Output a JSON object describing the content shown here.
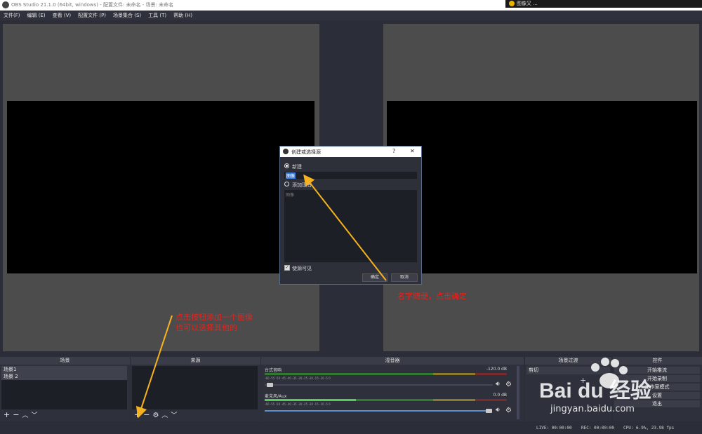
{
  "window": {
    "title": "OBS Studio 21.1.0 (64bit, windows) - 配置文件: 未命名 - 场景: 未命名",
    "popup_text": "图像又  ..."
  },
  "menu": [
    "文件(F)",
    "编辑 (E)",
    "查看 (V)",
    "配置文件 (P)",
    "场景集合 (S)",
    "工具 (T)",
    "帮助 (H)"
  ],
  "docks": {
    "scenes": {
      "title": "场景",
      "items": [
        "场景1",
        "场景 2"
      ]
    },
    "sources": {
      "title": "来源"
    },
    "mixer": {
      "title": "混音器",
      "channels": [
        {
          "name": "台式音响",
          "db": "-120.0 dB",
          "ticks": "-60  -55  -50  -45  -40  -35  -30  -25  -20  -15  -10  -5  0"
        },
        {
          "name": "麦克风/Aux",
          "db": "0.0 dB",
          "ticks": "-60  -55  -50  -45  -40  -35  -30  -25  -20  -15  -10  -5  0"
        }
      ]
    },
    "transitions": {
      "title": "场景过渡",
      "item": "剪切"
    },
    "controls": {
      "title": "控件",
      "buttons": [
        "开始推流",
        "开始录制",
        "工作室模式",
        "设置",
        "退出"
      ]
    }
  },
  "dialog": {
    "title": "创建或选择源",
    "help": "?",
    "close": "✕",
    "new_label": "新建",
    "name_value": "图像",
    "add_existing_label": "添加现有",
    "existing_items": [
      "图像"
    ],
    "visible_label": "使源可见",
    "ok": "确定",
    "cancel": "取消"
  },
  "annotations": {
    "dialog_hint": "名字随便，点击确定",
    "add_hint_1": "点击按钮添加一个图像",
    "add_hint_2": "也可以选择其他的"
  },
  "status": {
    "live": "LIVE: 00:00:00",
    "rec": "REC: 00:00:00",
    "cpu": "CPU: 6.9%, 23.98 fps"
  },
  "watermark": {
    "logo": "Bai du 经验",
    "url": "jingyan.baidu.com"
  },
  "colors": {
    "annotation": "#e8221b",
    "arrow": "#f5b21e",
    "accent": "#5b8fd4"
  }
}
